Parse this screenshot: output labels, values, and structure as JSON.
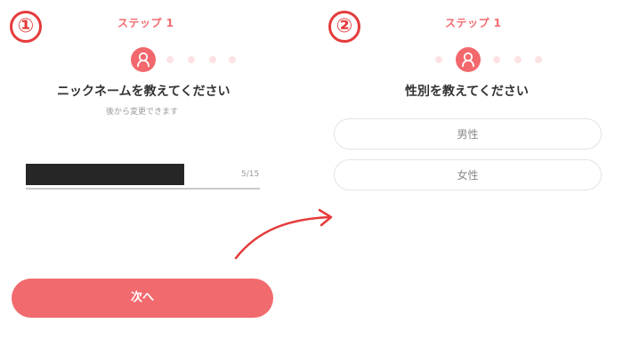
{
  "markers": {
    "first": "①",
    "second": "②"
  },
  "screen1": {
    "step_label": "ステップ 1",
    "title": "ニックネームを教えてください",
    "subtitle": "後から変更できます",
    "input_value": "",
    "counter": "5/15",
    "next_label": "次へ",
    "progress": {
      "total": 4,
      "current": 1
    }
  },
  "screen2": {
    "step_label": "ステップ 1",
    "title": "性別を教えてください",
    "options": [
      "男性",
      "女性"
    ],
    "progress": {
      "total": 5,
      "current": 2
    }
  },
  "colors": {
    "accent": "#f2686c",
    "dot_inactive": "#fde2e4",
    "marker": "#e53b3b",
    "arrow": "#e53b3b",
    "redaction": "#262626"
  },
  "icons": {
    "step_icon": "user-icon",
    "flow_arrow": "curved-arrow-icon"
  }
}
